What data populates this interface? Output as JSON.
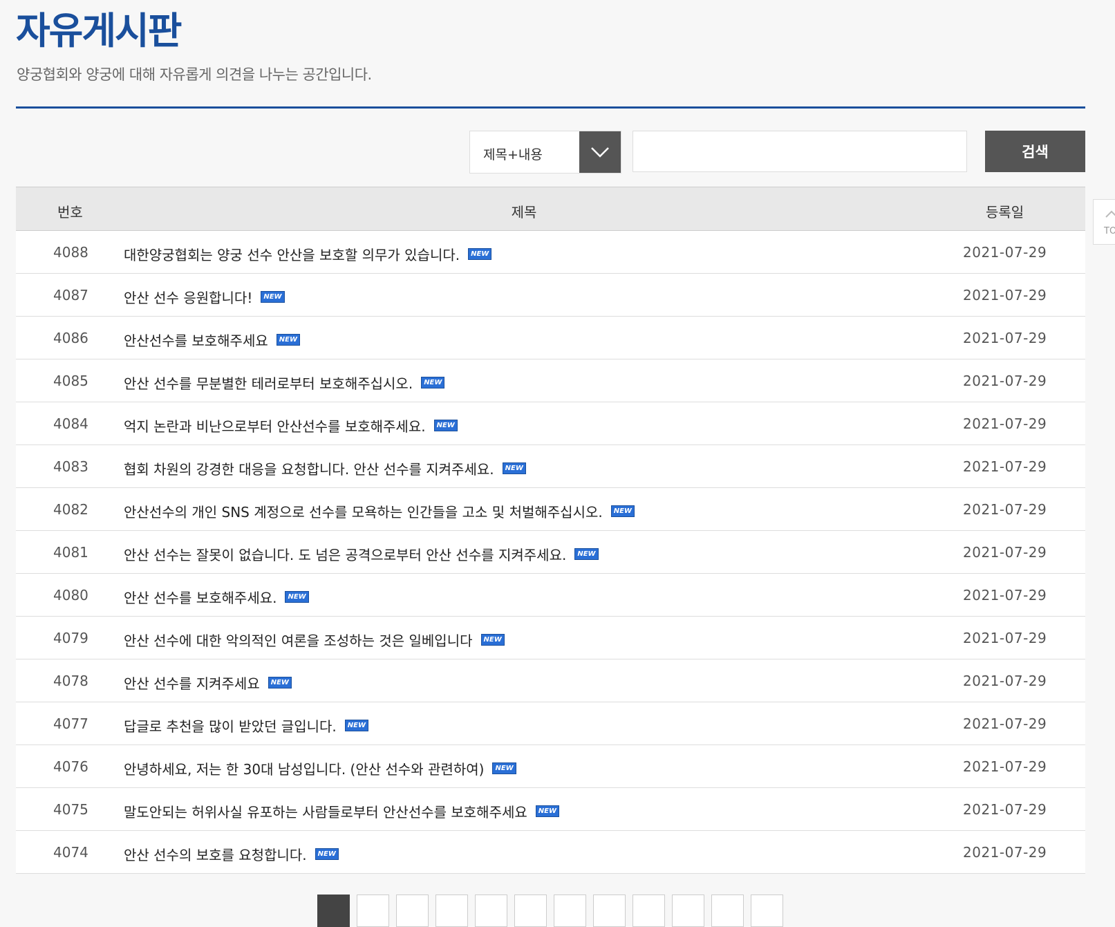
{
  "header": {
    "title": "자유게시판",
    "description": "양궁협회와 양궁에 대해 자유롭게 의견을 나누는 공간입니다."
  },
  "search": {
    "select_value": "제목+내용",
    "input_value": "",
    "button_label": "검색"
  },
  "table": {
    "columns": {
      "num": "번호",
      "title": "제목",
      "date": "등록일"
    },
    "new_label": "NEW",
    "rows": [
      {
        "num": "4088",
        "title": "대한양궁협회는 양궁 선수 안산을 보호할 의무가 있습니다.",
        "date": "2021-07-29"
      },
      {
        "num": "4087",
        "title": "안산 선수 응원합니다!",
        "date": "2021-07-29"
      },
      {
        "num": "4086",
        "title": "안산선수를 보호해주세요",
        "date": "2021-07-29"
      },
      {
        "num": "4085",
        "title": "안산 선수를 무분별한 테러로부터 보호해주십시오.",
        "date": "2021-07-29"
      },
      {
        "num": "4084",
        "title": "억지 논란과 비난으로부터 안산선수를 보호해주세요.",
        "date": "2021-07-29"
      },
      {
        "num": "4083",
        "title": "협회 차원의 강경한 대응을 요청합니다. 안산 선수를 지켜주세요.",
        "date": "2021-07-29"
      },
      {
        "num": "4082",
        "title": "안산선수의 개인 SNS 계정으로 선수를 모욕하는 인간들을 고소 및 처벌해주십시오.",
        "date": "2021-07-29"
      },
      {
        "num": "4081",
        "title": "안산 선수는 잘못이 없습니다. 도 넘은 공격으로부터 안산 선수를 지켜주세요.",
        "date": "2021-07-29"
      },
      {
        "num": "4080",
        "title": "안산 선수를 보호해주세요.",
        "date": "2021-07-29"
      },
      {
        "num": "4079",
        "title": "안산 선수에 대한 악의적인 여론을 조성하는 것은 일베입니다",
        "date": "2021-07-29"
      },
      {
        "num": "4078",
        "title": "안산 선수를 지켜주세요",
        "date": "2021-07-29"
      },
      {
        "num": "4077",
        "title": "답글로 추천을 많이 받았던 글입니다.",
        "date": "2021-07-29"
      },
      {
        "num": "4076",
        "title": "안녕하세요, 저는 한 30대 남성입니다. (안산 선수와 관련하여)",
        "date": "2021-07-29"
      },
      {
        "num": "4075",
        "title": "말도안되는 허위사실 유포하는 사람들로부터 안산선수를 보호해주세요",
        "date": "2021-07-29"
      },
      {
        "num": "4074",
        "title": "안산 선수의 보호를 요청합니다.",
        "date": "2021-07-29"
      }
    ]
  },
  "top_button": {
    "label": "TO"
  },
  "pagination": {
    "visible_count": 12,
    "active_index": 0
  }
}
